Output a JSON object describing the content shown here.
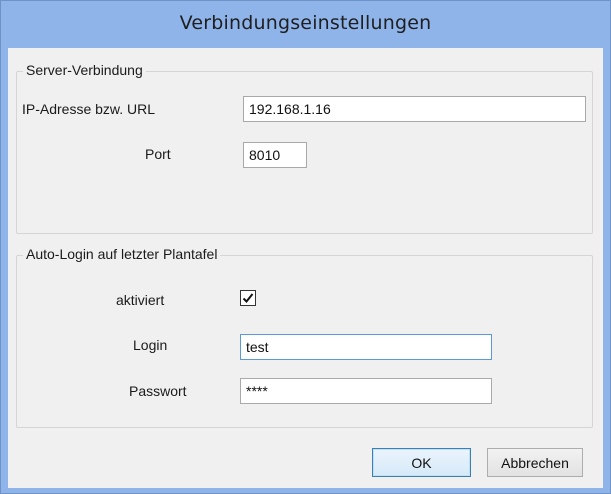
{
  "window": {
    "title": "Verbindungseinstellungen"
  },
  "server_group": {
    "legend": "Server-Verbindung",
    "ip_label": "IP-Adresse bzw. URL",
    "ip_value": "192.168.1.16",
    "port_label": "Port",
    "port_value": "8010"
  },
  "autologin_group": {
    "legend": "Auto-Login auf letzter Plantafel",
    "enabled_label": "aktiviert",
    "enabled_checked": true,
    "login_label": "Login",
    "login_value": "test",
    "password_label": "Passwort",
    "password_value": "****"
  },
  "buttons": {
    "ok": "OK",
    "cancel": "Abbrechen"
  },
  "colors": {
    "title_bar": "#8fb4ea",
    "dialog_bg": "#f0f0f0",
    "focus_border": "#5b9bd5"
  }
}
